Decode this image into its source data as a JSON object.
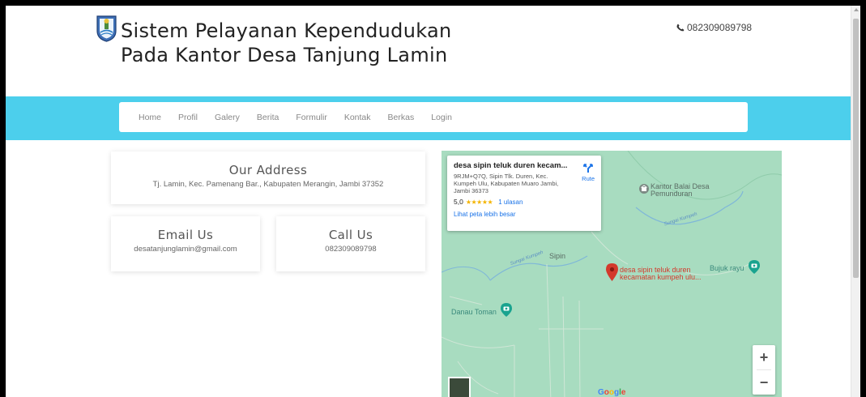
{
  "header": {
    "title": "Sistem Pelayanan Kependudukan Pada Kantor Desa Tanjung Lamin",
    "phone": "082309089798"
  },
  "nav": {
    "items": [
      "Home",
      "Profil",
      "Galery",
      "Berita",
      "Formulir",
      "Kontak",
      "Berkas",
      "Login"
    ]
  },
  "address_card": {
    "heading": "Our Address",
    "text": "Tj. Lamin, Kec. Pamenang Bar., Kabupaten Merangin, Jambi 37352"
  },
  "email_card": {
    "heading": "Email Us",
    "text": "desatanjunglamin@gmail.com"
  },
  "call_card": {
    "heading": "Call Us",
    "text": "082309089798"
  },
  "map": {
    "info": {
      "title": "desa sipin teluk duren kecam...",
      "address": "9RJM+Q7Q, Sipin Tlk. Duren, Kec. Kumpeh Ulu, Kabupaten Muaro Jambi, Jambi 36373",
      "rating": "5,0",
      "stars": "★★★★★",
      "reviews": "1 ulasan",
      "bigger_map": "Lihat peta lebih besar",
      "route": "Rute"
    },
    "labels": {
      "kantor_line1": "Kantor Balai Desa",
      "kantor_line2": "Pemunduran",
      "sipin": "Sipin",
      "pin_line1": "desa sipin teluk duren",
      "pin_line2": "kecamatan kumpeh ulu...",
      "bujuk": "Bujuk rayu",
      "danau": "Danau Toman",
      "river1": "Sungai Kumpeh",
      "river2": "Sungai Kumpeh",
      "google": "Google"
    },
    "zoom_in": "+",
    "zoom_out": "−"
  },
  "colors": {
    "nav_band": "#4ccfec",
    "map_bg": "#a8dcc0",
    "pin": "#d33a2c",
    "link": "#1a73e8"
  }
}
